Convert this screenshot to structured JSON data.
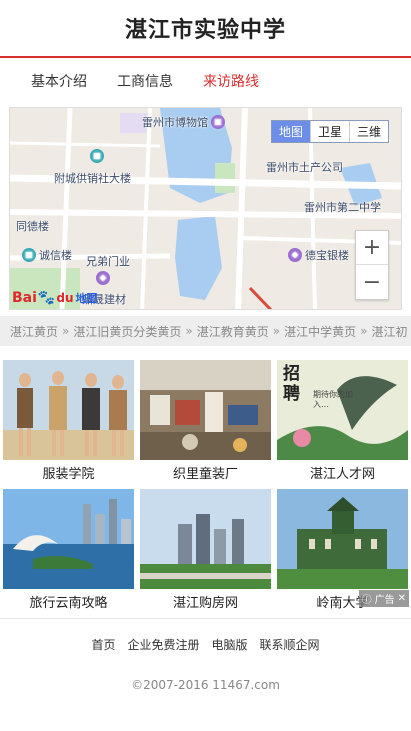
{
  "header": {
    "title": "湛江市实验中学"
  },
  "nav": {
    "items": [
      {
        "label": "基本介绍"
      },
      {
        "label": "工商信息"
      },
      {
        "label": "来访路线"
      }
    ]
  },
  "map": {
    "type_buttons": [
      "地图",
      "卫星",
      "三维"
    ],
    "zoom_in": "+",
    "zoom_out": "−",
    "logo": {
      "bai": "Bai",
      "du": "du",
      "word": "地图"
    },
    "pois": [
      "雷州市博物馆",
      "雷州市土产公司",
      "附城供销社大楼",
      "雷州市第二中学",
      "同德楼",
      "诚信楼",
      "兄弟门业",
      "德宝银楼",
      "鼎晟建材"
    ]
  },
  "breadcrumb": {
    "items": [
      "湛江黄页",
      "湛江旧黄页分类黄页",
      "湛江教育黄页",
      "湛江中学黄页",
      "湛江初"
    ],
    "separator": "»"
  },
  "ads": {
    "items": [
      {
        "label": "服装学院"
      },
      {
        "label": "织里童装厂"
      },
      {
        "label": "湛江人才网"
      },
      {
        "label": "旅行云南攻略"
      },
      {
        "label": "湛江购房网"
      },
      {
        "label": "岭南大学"
      }
    ],
    "recruit_big": "招聘",
    "recruit_small": "期待你的加入…",
    "badge": "广告",
    "badge_close": "✕"
  },
  "footer": {
    "links": [
      "首页",
      "企业免费注册",
      "电脑版",
      "联系顺企网"
    ],
    "copyright": "©2007-2016 11467.com"
  }
}
